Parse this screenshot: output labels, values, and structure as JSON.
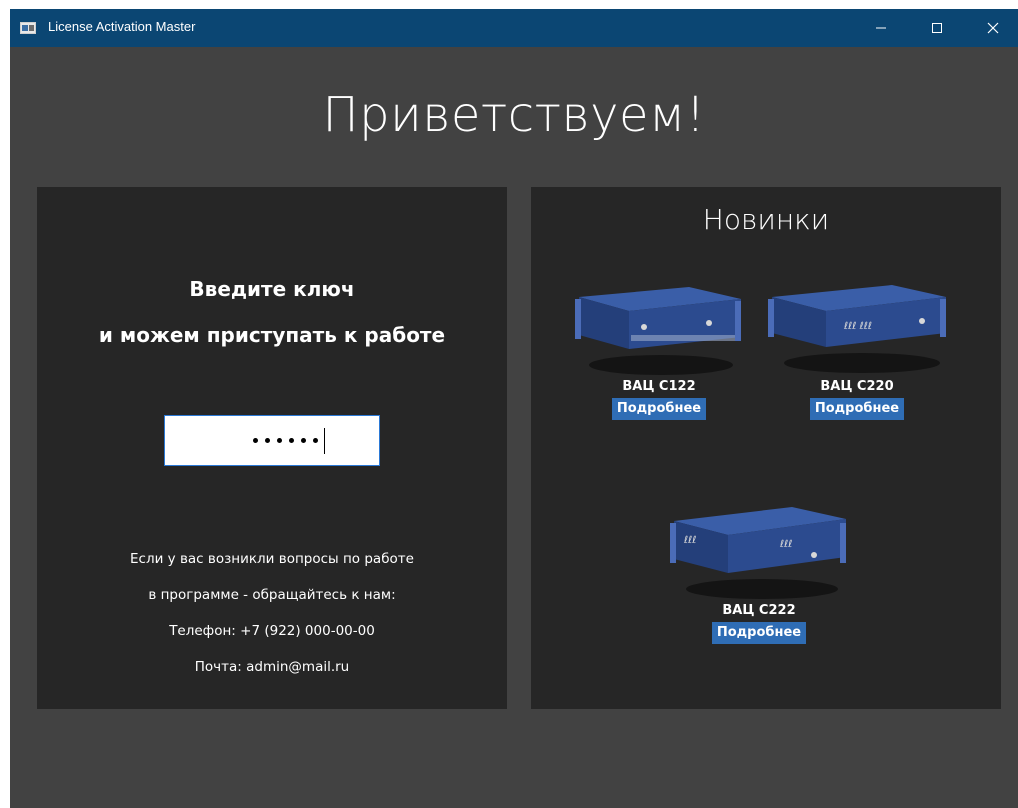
{
  "window": {
    "title": "License Activation Master"
  },
  "welcome": "Приветствуем!",
  "activation": {
    "prompt_line1": "Введите ключ",
    "prompt_line2": "и можем приступать к работе",
    "masked_value": "••••••"
  },
  "contact": {
    "line1": "Если у вас возникли вопросы по работе",
    "line2": "в программе - обращайтесь к нам:",
    "phone": "Телефон: +7 (922) 000-00-00",
    "email": "Почта: admin@mail.ru"
  },
  "news": {
    "title": "Новинки",
    "products": [
      {
        "name": "ВАЦ С122",
        "button": "Подробнее"
      },
      {
        "name": "ВАЦ С220",
        "button": "Подробнее"
      },
      {
        "name": "ВАЦ С222",
        "button": "Подробнее"
      }
    ]
  },
  "icons": {
    "app": "app-window-icon",
    "minimize": "minimize-icon",
    "maximize": "maximize-icon",
    "close": "close-icon"
  }
}
